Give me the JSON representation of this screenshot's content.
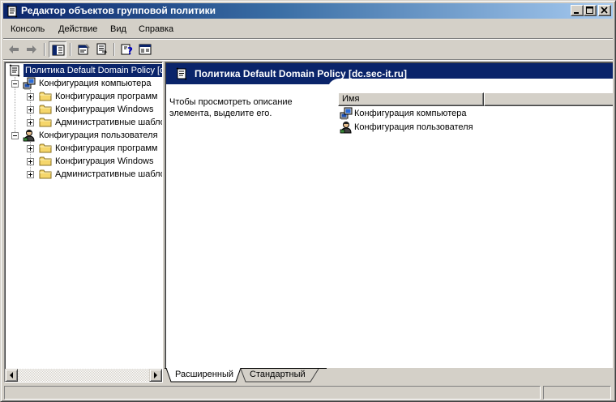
{
  "window": {
    "title": "Редактор объектов групповой политики",
    "controls": [
      "minimize",
      "maximize",
      "close"
    ]
  },
  "menu": {
    "items": [
      "Консоль",
      "Действие",
      "Вид",
      "Справка"
    ]
  },
  "toolbar": {
    "icons": [
      "back-arrow-icon",
      "forward-arrow-icon",
      "show-hide-tree-icon",
      "properties-icon",
      "export-list-icon",
      "help-icon",
      "console-tree-icon"
    ]
  },
  "tree": {
    "root": "Политика Default Domain Policy [dc.sec-it.ru]",
    "nodes": [
      {
        "label": "Конфигурация компьютера",
        "children": [
          "Конфигурация программ",
          "Конфигурация Windows",
          "Административные шаблоны"
        ]
      },
      {
        "label": "Конфигурация пользователя",
        "children": [
          "Конфигурация программ",
          "Конфигурация Windows",
          "Административные шаблоны"
        ]
      }
    ]
  },
  "details": {
    "header": "Политика Default Domain Policy [dc.sec-it.ru]",
    "description": "Чтобы просмотреть описание элемента, выделите его.",
    "column": "Имя",
    "items": [
      "Конфигурация компьютера",
      "Конфигурация пользователя"
    ]
  },
  "tabs": [
    "Расширенный",
    "Стандартный"
  ],
  "colors": {
    "title_start": "#0a246a",
    "title_end": "#a6caf0",
    "header_bg": "#0a246a",
    "face": "#d4d0c8",
    "folder": "#f5d66b"
  }
}
